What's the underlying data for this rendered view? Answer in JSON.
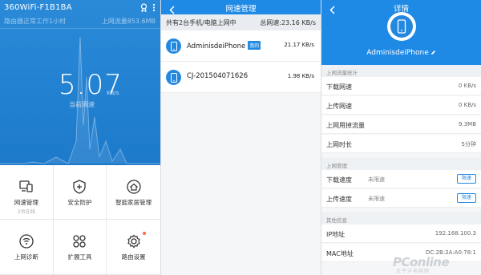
{
  "panel1": {
    "title": "360WiFi-F1B1BA",
    "status": "路由器正常工作1小时",
    "flow": "上网流量853.6MB",
    "speed": "5.07",
    "unit": "KB/s",
    "speed_label": "当前网速",
    "tiles": [
      {
        "label": "网速管理",
        "sub": "2台在线",
        "icon": "network-speed-icon"
      },
      {
        "label": "安全防护",
        "sub": "",
        "icon": "shield-plus-icon"
      },
      {
        "label": "智能家居管理",
        "sub": "",
        "icon": "smart-home-icon"
      },
      {
        "label": "上网诊断",
        "sub": "",
        "icon": "diagnosis-icon"
      },
      {
        "label": "扩展工具",
        "sub": "",
        "icon": "tools-dots-icon"
      },
      {
        "label": "路由设置",
        "sub": "",
        "icon": "gear-icon"
      }
    ]
  },
  "panel2": {
    "title": "网速管理",
    "summary_left": "共有2台手机/电脑上网中",
    "summary_right": "总网速:23.16 KB/s",
    "devices": [
      {
        "name": "AdminisdeiPhone",
        "tag": "我的",
        "speed": "21.17 KB/s"
      },
      {
        "name": "CJ-201504071626",
        "tag": "",
        "speed": "1.98 KB/s"
      }
    ]
  },
  "panel3": {
    "title": "详情",
    "device_name": "AdminisdeiPhone",
    "sec_stats": "上网流量统计",
    "stats": [
      {
        "key": "下载网速",
        "value": "0 KB/s"
      },
      {
        "key": "上传网速",
        "value": "0 KB/s"
      },
      {
        "key": "上网用掉流量",
        "value": "9.3MB"
      },
      {
        "key": "上网时长",
        "value": "5分钟"
      }
    ],
    "sec_manage": "上网管理",
    "manage": [
      {
        "key": "下载速度",
        "mode": "未限速",
        "button": "限速"
      },
      {
        "key": "上传速度",
        "mode": "未限速",
        "button": "限速"
      }
    ],
    "sec_other": "其他信息",
    "other": [
      {
        "key": "IP地址",
        "value": "192.168.100.3"
      },
      {
        "key": "MAC地址",
        "value": "DC:2B:2A:A0:78:1"
      }
    ]
  },
  "watermark": {
    "text": "PConline",
    "sub": "太平洋电脑网"
  },
  "colors": {
    "primary": "#1f8ae6",
    "hero": "#2a8ad8",
    "accent_dot": "#ff6a3c"
  }
}
